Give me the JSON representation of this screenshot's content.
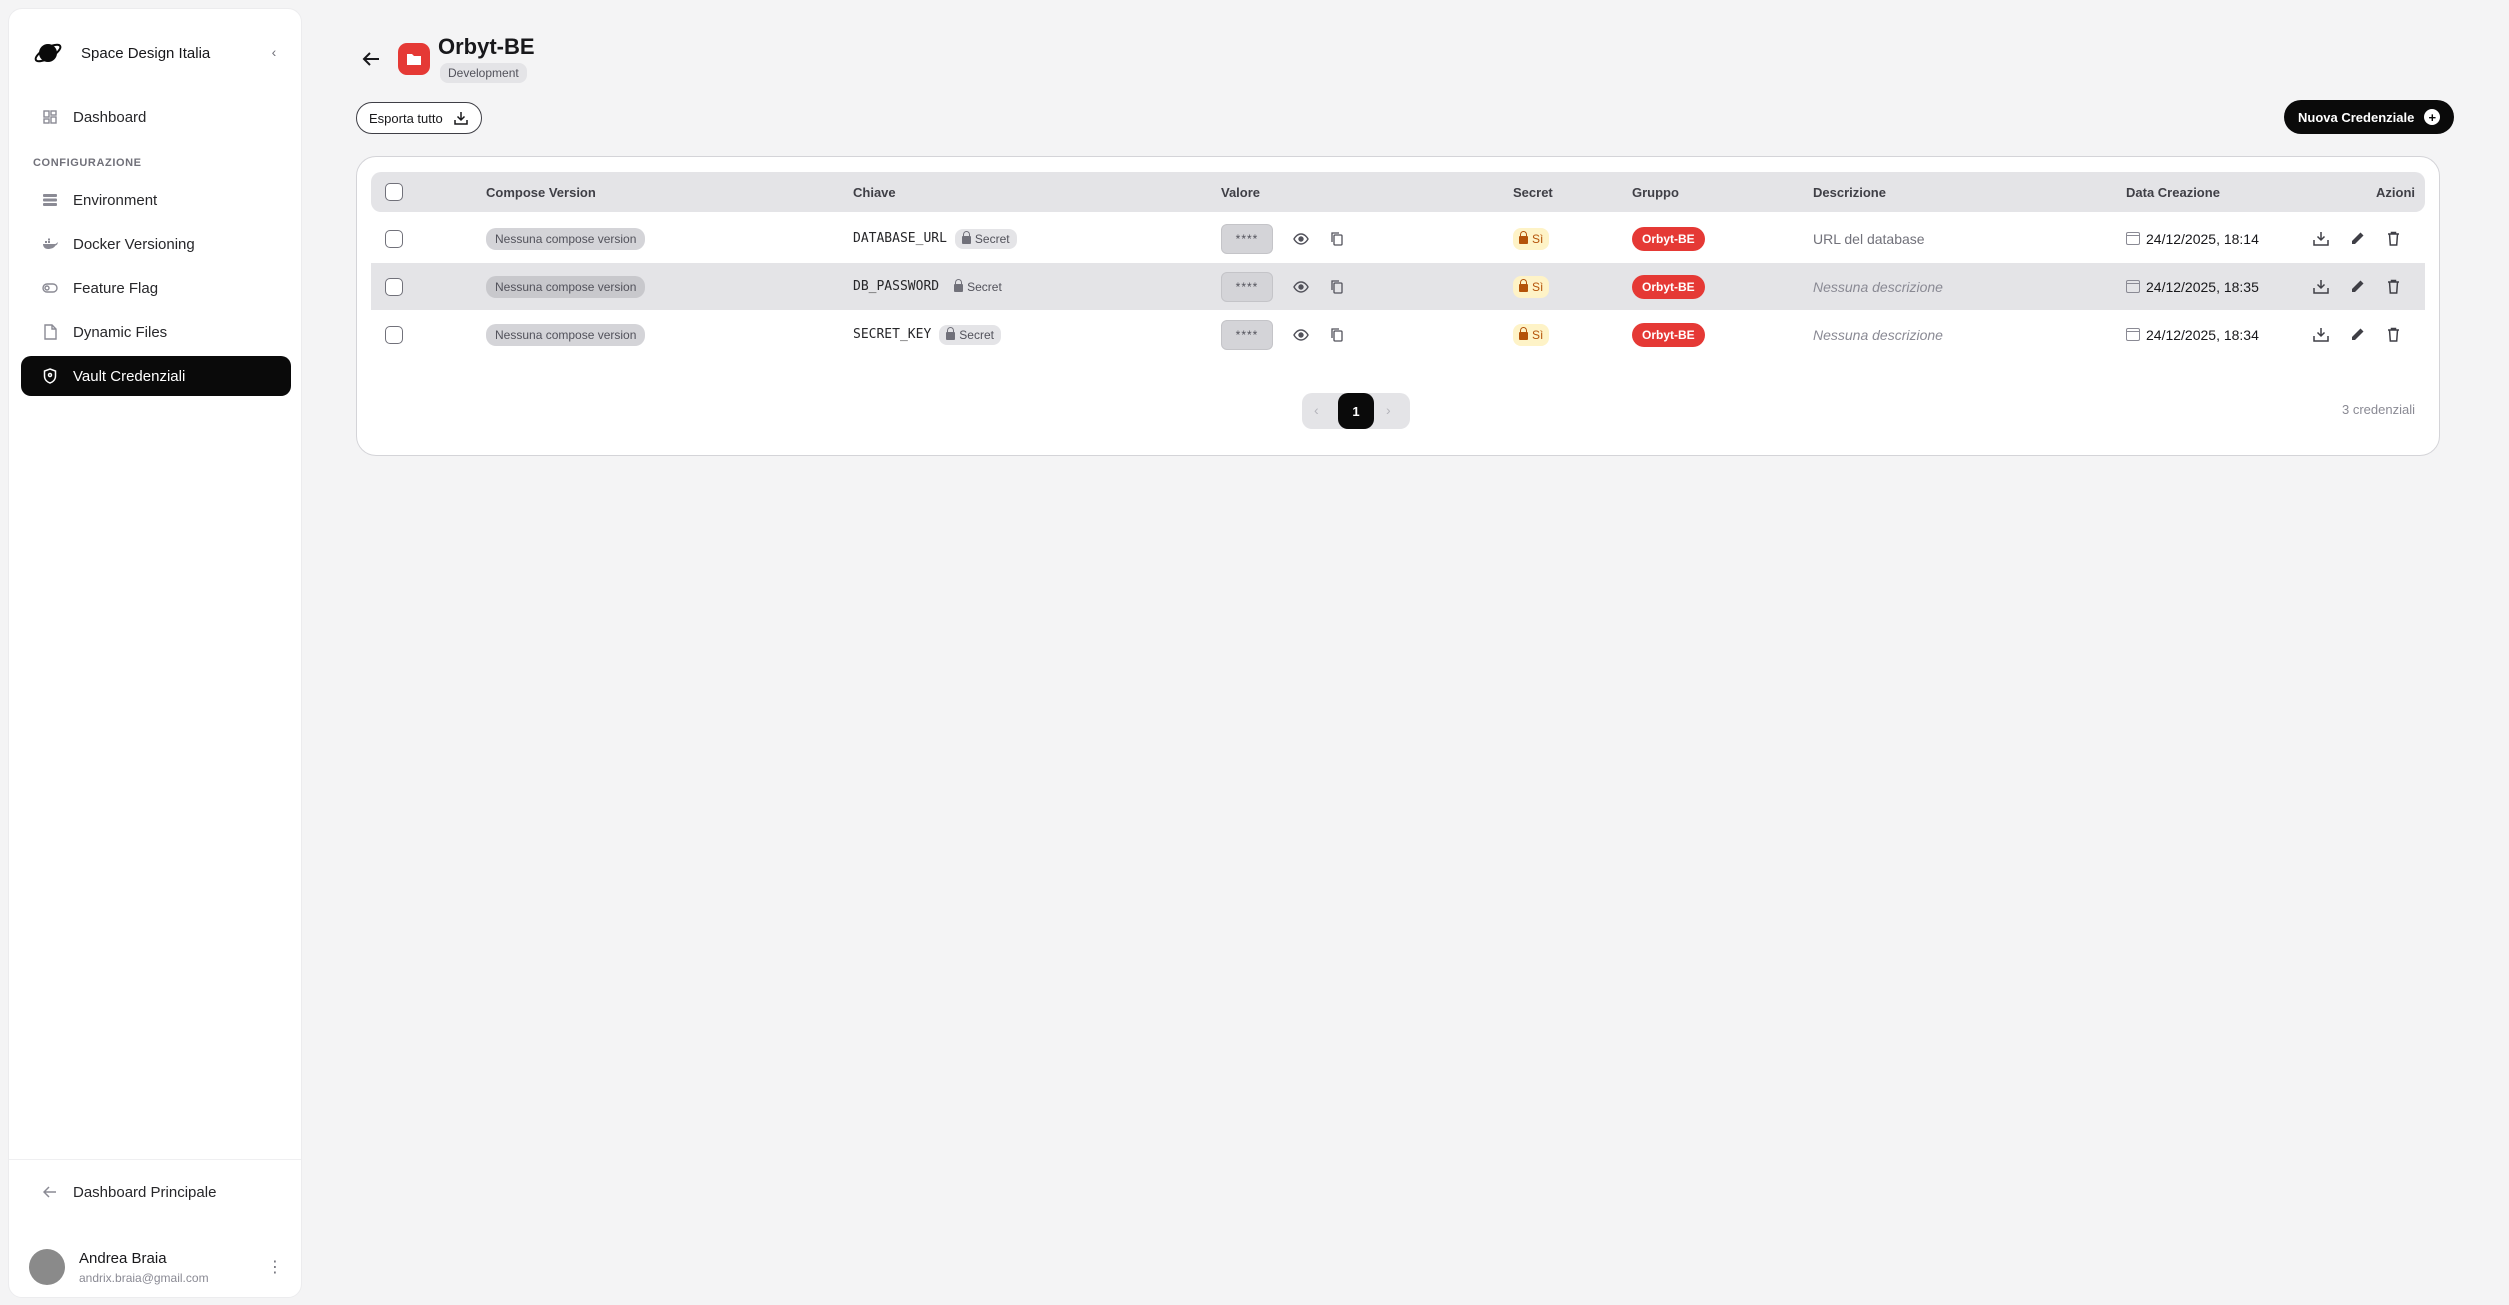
{
  "sidebar": {
    "org_name": "Space Design Italia",
    "dashboard_label": "Dashboard",
    "section_label": "CONFIGURAZIONE",
    "items": [
      {
        "label": "Environment",
        "icon": "server-icon"
      },
      {
        "label": "Docker Versioning",
        "icon": "docker-icon"
      },
      {
        "label": "Feature Flag",
        "icon": "toggle-icon"
      },
      {
        "label": "Dynamic Files",
        "icon": "file-icon"
      },
      {
        "label": "Vault Credenziali",
        "icon": "shield-icon",
        "active": true
      }
    ],
    "back_label": "Dashboard Principale",
    "user": {
      "name": "Andrea Braia",
      "email": "andrix.braia@gmail.com"
    }
  },
  "project": {
    "title": "Orbyt-BE",
    "environment": "Development",
    "color": "#e53935"
  },
  "toolbar": {
    "export_label": "Esporta tutto",
    "new_label": "Nuova Credenziale"
  },
  "table": {
    "headers": {
      "compose": "Compose Version",
      "key": "Chiave",
      "value": "Valore",
      "secret": "Secret",
      "group": "Gruppo",
      "description": "Descrizione",
      "created": "Data Creazione",
      "actions": "Azioni"
    },
    "rows": [
      {
        "compose": "Nessuna compose version",
        "key": "DATABASE_URL",
        "tag": "Secret",
        "value": "****",
        "secret": "Sì",
        "group": "Orbyt-BE",
        "description": "URL del database",
        "created": "24/12/2025, 18:14"
      },
      {
        "compose": "Nessuna compose version",
        "key": "DB_PASSWORD",
        "tag": "Secret",
        "value": "****",
        "secret": "Sì",
        "group": "Orbyt-BE",
        "description": "Nessuna descrizione",
        "created": "24/12/2025, 18:35"
      },
      {
        "compose": "Nessuna compose version",
        "key": "SECRET_KEY",
        "tag": "Secret",
        "value": "****",
        "secret": "Sì",
        "group": "Orbyt-BE",
        "description": "Nessuna descrizione",
        "created": "24/12/2025, 18:34"
      }
    ]
  },
  "pagination": {
    "prev": "‹",
    "current": "1",
    "next": "›"
  },
  "count_label": "3 credenziali",
  "colors": {
    "accent": "#0a0a0a",
    "group_badge": "#e53935",
    "secret_badge": "#fef3c7"
  }
}
